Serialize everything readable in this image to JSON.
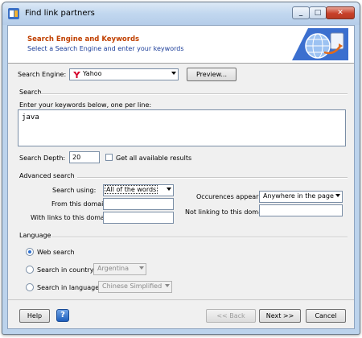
{
  "window": {
    "title": "Find link partners"
  },
  "banner": {
    "title": "Search Engine and Keywords",
    "subtitle": "Select a Search Engine and enter your keywords"
  },
  "engine": {
    "label": "Search Engine:",
    "value": "Yahoo",
    "preview_label": "Preview..."
  },
  "search": {
    "group_title": "Search",
    "keywords_label": "Enter your keywords below, one per line:",
    "keywords_value": "java",
    "depth_label": "Search Depth:",
    "depth_value": "20",
    "get_all_label": "Get all available results"
  },
  "advanced": {
    "group_title": "Advanced search",
    "search_using_label": "Search using:",
    "search_using_value": "All of the words",
    "from_domain_label": "From this domain",
    "with_links_label": "With links to this domain",
    "occurrences_label": "Occurences appear:",
    "occurrences_value": "Anywhere in the page",
    "not_linking_label": "Not linking to this domain"
  },
  "language": {
    "group_title": "Language",
    "web_search_label": "Web search",
    "country_label": "Search in country",
    "country_value": "Argentina",
    "language_label": "Search in language",
    "language_value": "Chinese Simplified"
  },
  "footer": {
    "help": "Help",
    "help_icon": "?",
    "back": "<< Back",
    "next": "Next >>",
    "cancel": "Cancel"
  },
  "colors": {
    "banner_title": "#c04000",
    "banner_subtitle": "#1a3c98"
  },
  "icons": {
    "app": "link-app-icon",
    "yahoo": "yahoo-y-icon",
    "globe": "globe-link-icon"
  }
}
